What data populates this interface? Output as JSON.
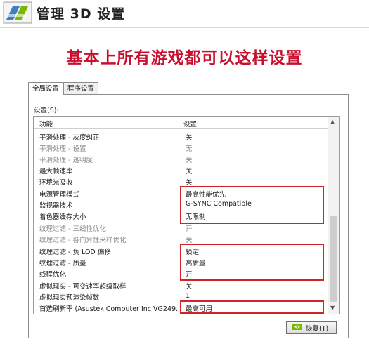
{
  "window": {
    "title": "管理 3D 设置"
  },
  "headline": "基本上所有游戏都可以这样设置",
  "tabs": [
    {
      "label": "全局设置",
      "active": true
    },
    {
      "label": "程序设置",
      "active": false
    }
  ],
  "settings_label": "设置(S):",
  "table": {
    "columns": [
      "功能",
      "设置"
    ],
    "rows": [
      {
        "feature": "平滑处理 - 灰度纠正",
        "value": "关",
        "dim": false
      },
      {
        "feature": "平滑处理 - 设置",
        "value": "无",
        "dim": true
      },
      {
        "feature": "平滑处理 - 透明度",
        "value": "关",
        "dim": true
      },
      {
        "feature": "最大帧速率",
        "value": "关",
        "dim": false
      },
      {
        "feature": "环境光吸收",
        "value": "关",
        "dim": false
      },
      {
        "feature": "电源管理模式",
        "value": "最高性能优先",
        "dim": false
      },
      {
        "feature": "监视器技术",
        "value": "G-SYNC Compatible",
        "dim": false
      },
      {
        "feature": "着色器缓存大小",
        "value": "无限制",
        "dim": false
      },
      {
        "feature": "纹理过滤 - 三线性优化",
        "value": "开",
        "dim": true
      },
      {
        "feature": "纹理过滤 - 各向异性采样优化",
        "value": "关",
        "dim": true
      },
      {
        "feature": "纹理过滤 - 负 LOD 偏移",
        "value": "锁定",
        "dim": false
      },
      {
        "feature": "纹理过滤 - 质量",
        "value": "高质量",
        "dim": false
      },
      {
        "feature": "线程优化",
        "value": "开",
        "dim": false
      },
      {
        "feature": "虚拟现实 - 可变速率超级取样",
        "value": "关",
        "dim": false
      },
      {
        "feature": "虚拟现实预渲染帧数",
        "value": "1",
        "dim": false
      },
      {
        "feature": "首选刷新率 (Asustek Computer Inc VG249...",
        "value": "最高可用",
        "dim": false
      }
    ]
  },
  "restore_button": {
    "label": "恢复(T)"
  },
  "colors": {
    "highlight": "#d4222a",
    "headline": "#c8102e"
  },
  "icons": [
    "nvidia-3d-icon",
    "scroll-up-arrow-icon",
    "scroll-down-arrow-icon",
    "nvidia-restore-icon"
  ]
}
